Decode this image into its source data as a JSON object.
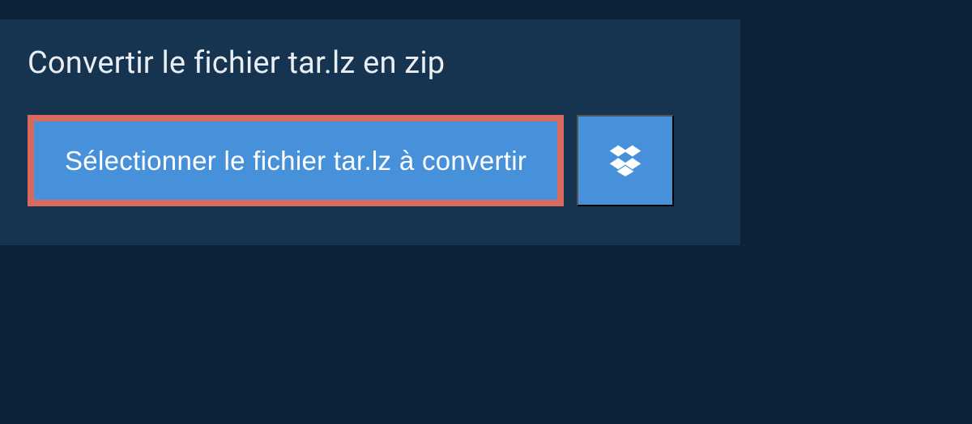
{
  "header": {
    "title": "Convertir le fichier tar.lz en zip"
  },
  "actions": {
    "select_file_label": "Sélectionner le fichier tar.lz à convertir"
  }
}
